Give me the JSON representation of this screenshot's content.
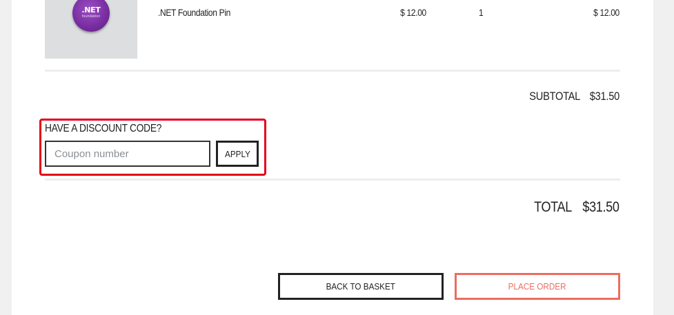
{
  "order_item": {
    "image_alt": ".NET Foundation Pin",
    "pin_text": ".NET",
    "pin_subtext": "foundation",
    "name": ".NET Foundation Pin",
    "price": "$ 12.00",
    "quantity": "1",
    "line_total": "$ 12.00"
  },
  "summary": {
    "subtotal_label": "SUBTOTAL",
    "subtotal_value": "$31.50",
    "total_label": "TOTAL",
    "total_value": "$31.50"
  },
  "discount": {
    "title": "HAVE A DISCOUNT CODE?",
    "input_value": "",
    "input_placeholder": "Coupon number",
    "apply_label": "APPLY"
  },
  "actions": {
    "back_label": "BACK TO BASKET",
    "place_order_label": "PLACE ORDER"
  },
  "colors": {
    "highlight_border": "#e3001b",
    "place_order_accent": "#eb6d5f",
    "pin_purple": "#7a2fa3"
  }
}
